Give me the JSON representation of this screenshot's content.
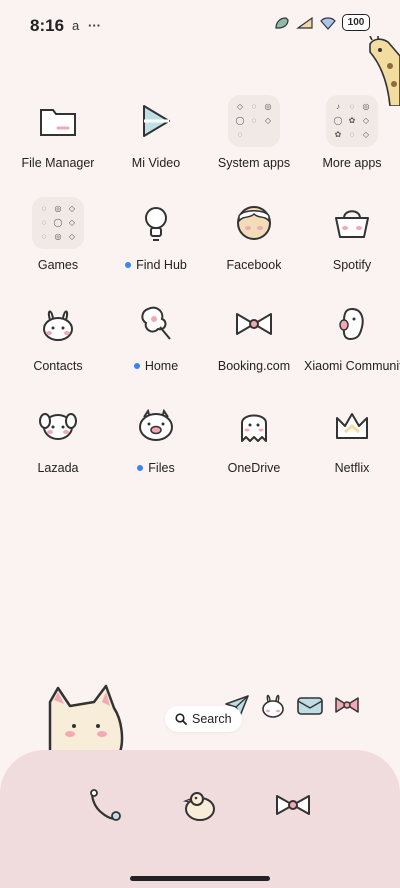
{
  "status_bar": {
    "time": "8:16",
    "notification_glyph": "a",
    "more": "···",
    "battery": "100"
  },
  "apps": [
    {
      "label": "File Manager",
      "icon": "folder-icon",
      "dot": false
    },
    {
      "label": "Mi Video",
      "icon": "play-icon",
      "dot": false
    },
    {
      "label": "System apps",
      "icon": "folder-grid",
      "dot": false
    },
    {
      "label": "More apps",
      "icon": "folder-grid",
      "dot": false
    },
    {
      "label": "Games",
      "icon": "folder-grid",
      "dot": false
    },
    {
      "label": "Find Hub",
      "icon": "lightbulb-icon",
      "dot": true
    },
    {
      "label": "Facebook",
      "icon": "cookie-icon",
      "dot": false
    },
    {
      "label": "Spotify",
      "icon": "basket-icon",
      "dot": false
    },
    {
      "label": "Contacts",
      "icon": "bunny-icon",
      "dot": false
    },
    {
      "label": "Home",
      "icon": "lollipop-icon",
      "dot": true
    },
    {
      "label": "Booking.com",
      "icon": "bow-icon",
      "dot": false
    },
    {
      "label": "Xiaomi Community",
      "icon": "penguin-icon",
      "dot": false
    },
    {
      "label": "Lazada",
      "icon": "puppy-icon",
      "dot": false
    },
    {
      "label": "Files",
      "icon": "pig-icon",
      "dot": true
    },
    {
      "label": "OneDrive",
      "icon": "ghost-icon",
      "dot": false
    },
    {
      "label": "Netflix",
      "icon": "crown-icon",
      "dot": false
    }
  ],
  "search": {
    "label": "Search"
  },
  "dock": [
    "phone-icon",
    "chick-icon",
    "bow-icon"
  ],
  "colors": {
    "background": "#fbf3f1",
    "dock": "#f1dcdd",
    "dot": "#3b82f6",
    "accent_blush": "#f3a9b3"
  }
}
